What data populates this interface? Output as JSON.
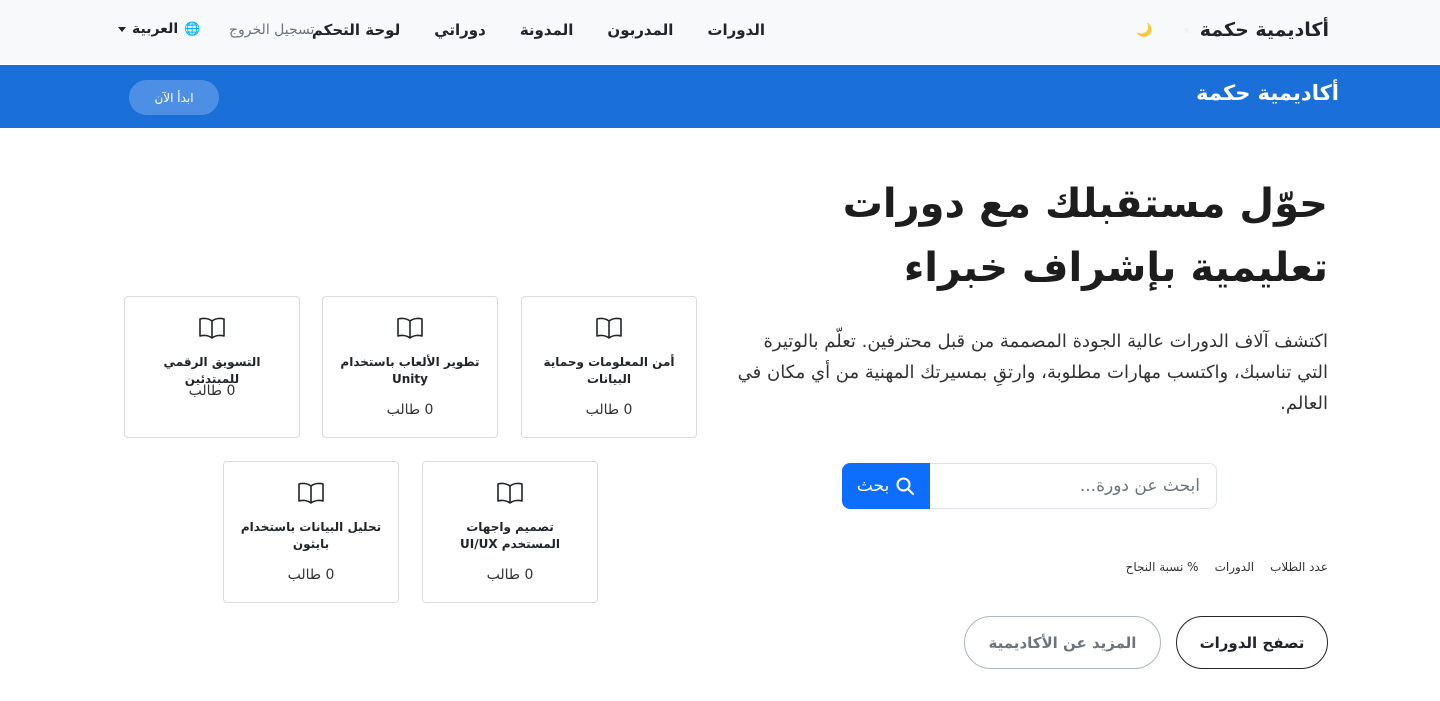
{
  "nav": {
    "brand": "أكاديمية حكمة",
    "theme_icon": "moon-icon",
    "links": [
      "الدورات",
      "المدربون",
      "المدونة",
      "دوراتي",
      "لوحة التحكم"
    ],
    "logout": "تسجيل الخروج",
    "language": "العربية",
    "language_icon": "globe-icon"
  },
  "banner": {
    "brand": "أكاديمية حكمة",
    "start_button": "ابدأ الآن"
  },
  "hero": {
    "title": "حوّل مستقبلك مع دورات تعليمية بإشراف خبراء",
    "description": "اكتشف آلاف الدورات عالية الجودة المصممة من قبل محترفين. تعلّم بالوتيرة التي تناسبك، واكتسب مهارات مطلوبة، وارتقِ بمسيرتك المهنية من أي مكان في العالم.",
    "search_placeholder": "ابحث عن دورة...",
    "search_button": "بحث",
    "stats": [
      "عدد الطلاب",
      "الدورات",
      "نسبة النجاح %"
    ],
    "browse_button": "تصفح الدورات",
    "more_button": "المزيد عن الأكاديمية"
  },
  "cards": [
    {
      "title": "أمن المعلومات وحماية البيانات",
      "count": "0 طالب"
    },
    {
      "title": "تطوير الألعاب باستخدام Unity",
      "count": "0 طالب"
    },
    {
      "title": "التسويق الرقمي للمبتدئين",
      "count": "0 طالب"
    },
    {
      "title": "تصميم واجهات المستخدم UI/UX",
      "count": "0 طالب"
    },
    {
      "title": "تحليل البيانات باستخدام بايثون",
      "count": "0 طالب"
    }
  ],
  "colors": {
    "primary": "#0d6efd",
    "banner": "#1a6fd8"
  }
}
